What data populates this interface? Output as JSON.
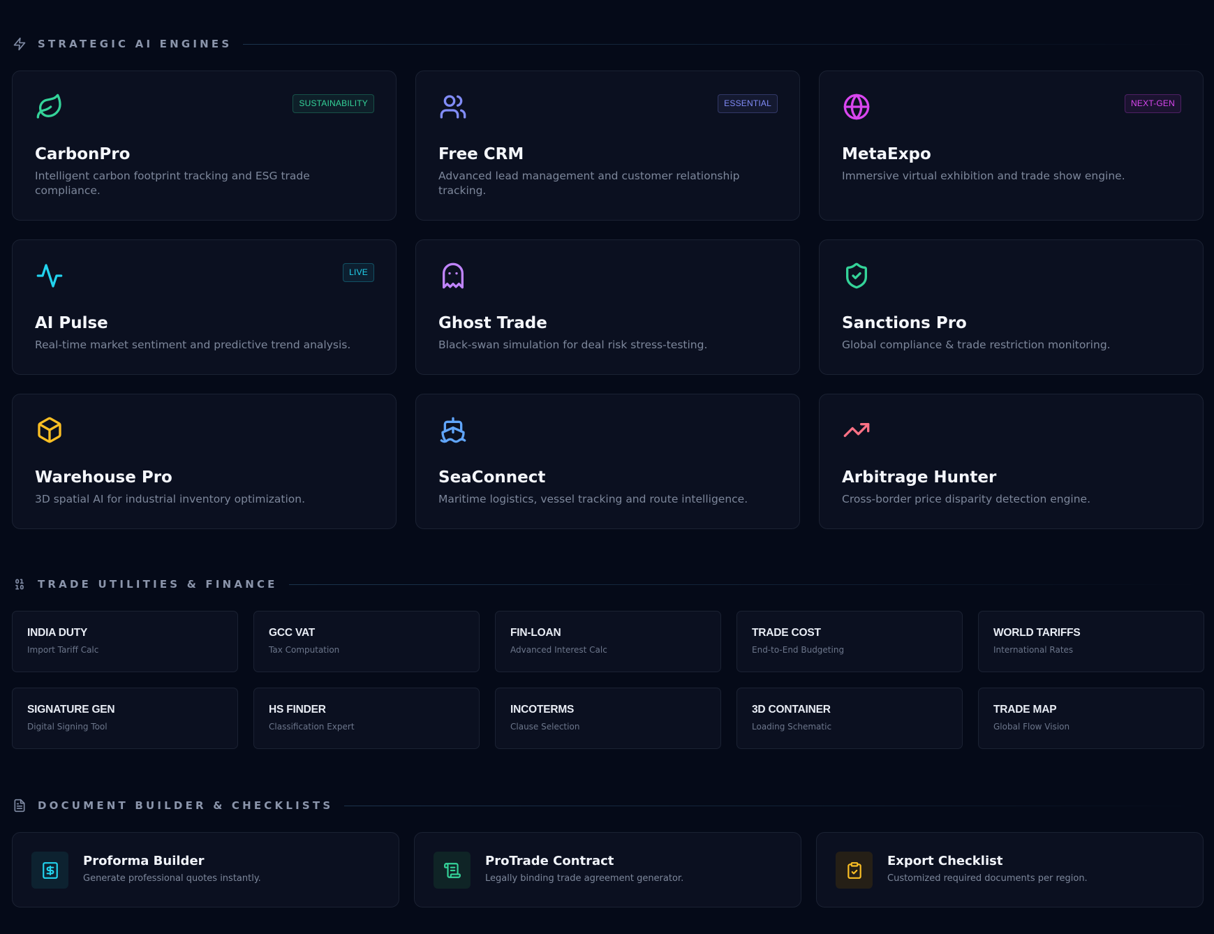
{
  "sections": {
    "engines": {
      "title": "STRATEGIC AI ENGINES",
      "icon": "zap-icon"
    },
    "utilities": {
      "title": "TRADE UTILITIES & FINANCE",
      "icon": "binary-icon"
    },
    "documents": {
      "title": "DOCUMENT BUILDER & CHECKLISTS",
      "icon": "file-text-icon"
    }
  },
  "engines": [
    {
      "name": "CarbonPro",
      "description": "Intelligent carbon footprint tracking and ESG trade compliance.",
      "badge": "SUSTAINABILITY",
      "icon": "leaf-icon",
      "color": "#34d399"
    },
    {
      "name": "Free CRM",
      "description": "Advanced lead management and customer relationship tracking.",
      "badge": "ESSENTIAL",
      "icon": "users-icon",
      "color": "#818cf8"
    },
    {
      "name": "MetaExpo",
      "description": "Immersive virtual exhibition and trade show engine.",
      "badge": "NEXT-GEN",
      "icon": "globe-icon",
      "color": "#d946ef"
    },
    {
      "name": "AI Pulse",
      "description": "Real-time market sentiment and predictive trend analysis.",
      "badge": "LIVE",
      "icon": "activity-icon",
      "color": "#22d3ee"
    },
    {
      "name": "Ghost Trade",
      "description": "Black-swan simulation for deal risk stress-testing.",
      "badge": "",
      "icon": "ghost-icon",
      "color": "#c084fc"
    },
    {
      "name": "Sanctions Pro",
      "description": "Global compliance & trade restriction monitoring.",
      "badge": "",
      "icon": "shield-check-icon",
      "color": "#34d399"
    },
    {
      "name": "Warehouse Pro",
      "description": "3D spatial AI for industrial inventory optimization.",
      "badge": "",
      "icon": "box-icon",
      "color": "#fbbf24"
    },
    {
      "name": "SeaConnect",
      "description": "Maritime logistics, vessel tracking and route intelligence.",
      "badge": "",
      "icon": "ship-icon",
      "color": "#60a5fa"
    },
    {
      "name": "Arbitrage Hunter",
      "description": "Cross-border price disparity detection engine.",
      "badge": "",
      "icon": "trending-up-icon",
      "color": "#fb7185"
    }
  ],
  "utilities": [
    {
      "title": "INDIA DUTY",
      "subtitle": "Import Tariff Calc"
    },
    {
      "title": "GCC VAT",
      "subtitle": "Tax Computation"
    },
    {
      "title": "FIN-LOAN",
      "subtitle": "Advanced Interest Calc"
    },
    {
      "title": "TRADE COST",
      "subtitle": "End-to-End Budgeting"
    },
    {
      "title": "WORLD TARIFFS",
      "subtitle": "International Rates"
    },
    {
      "title": "SIGNATURE GEN",
      "subtitle": "Digital Signing Tool"
    },
    {
      "title": "HS FINDER",
      "subtitle": "Classification Expert"
    },
    {
      "title": "INCOTERMS",
      "subtitle": "Clause Selection"
    },
    {
      "title": "3D CONTAINER",
      "subtitle": "Loading Schematic"
    },
    {
      "title": "TRADE MAP",
      "subtitle": "Global Flow Vision"
    }
  ],
  "documents": [
    {
      "title": "Proforma Builder",
      "subtitle": "Generate professional quotes instantly.",
      "icon": "receipt-icon",
      "color": "#22d3ee",
      "bg": "#0d2230"
    },
    {
      "title": "ProTrade Contract",
      "subtitle": "Legally binding trade agreement generator.",
      "icon": "scroll-icon",
      "color": "#34d399",
      "bg": "#0f2426"
    },
    {
      "title": "Export Checklist",
      "subtitle": "Customized required documents per region.",
      "icon": "clipboard-check-icon",
      "color": "#fbbf24",
      "bg": "#251f16"
    }
  ]
}
